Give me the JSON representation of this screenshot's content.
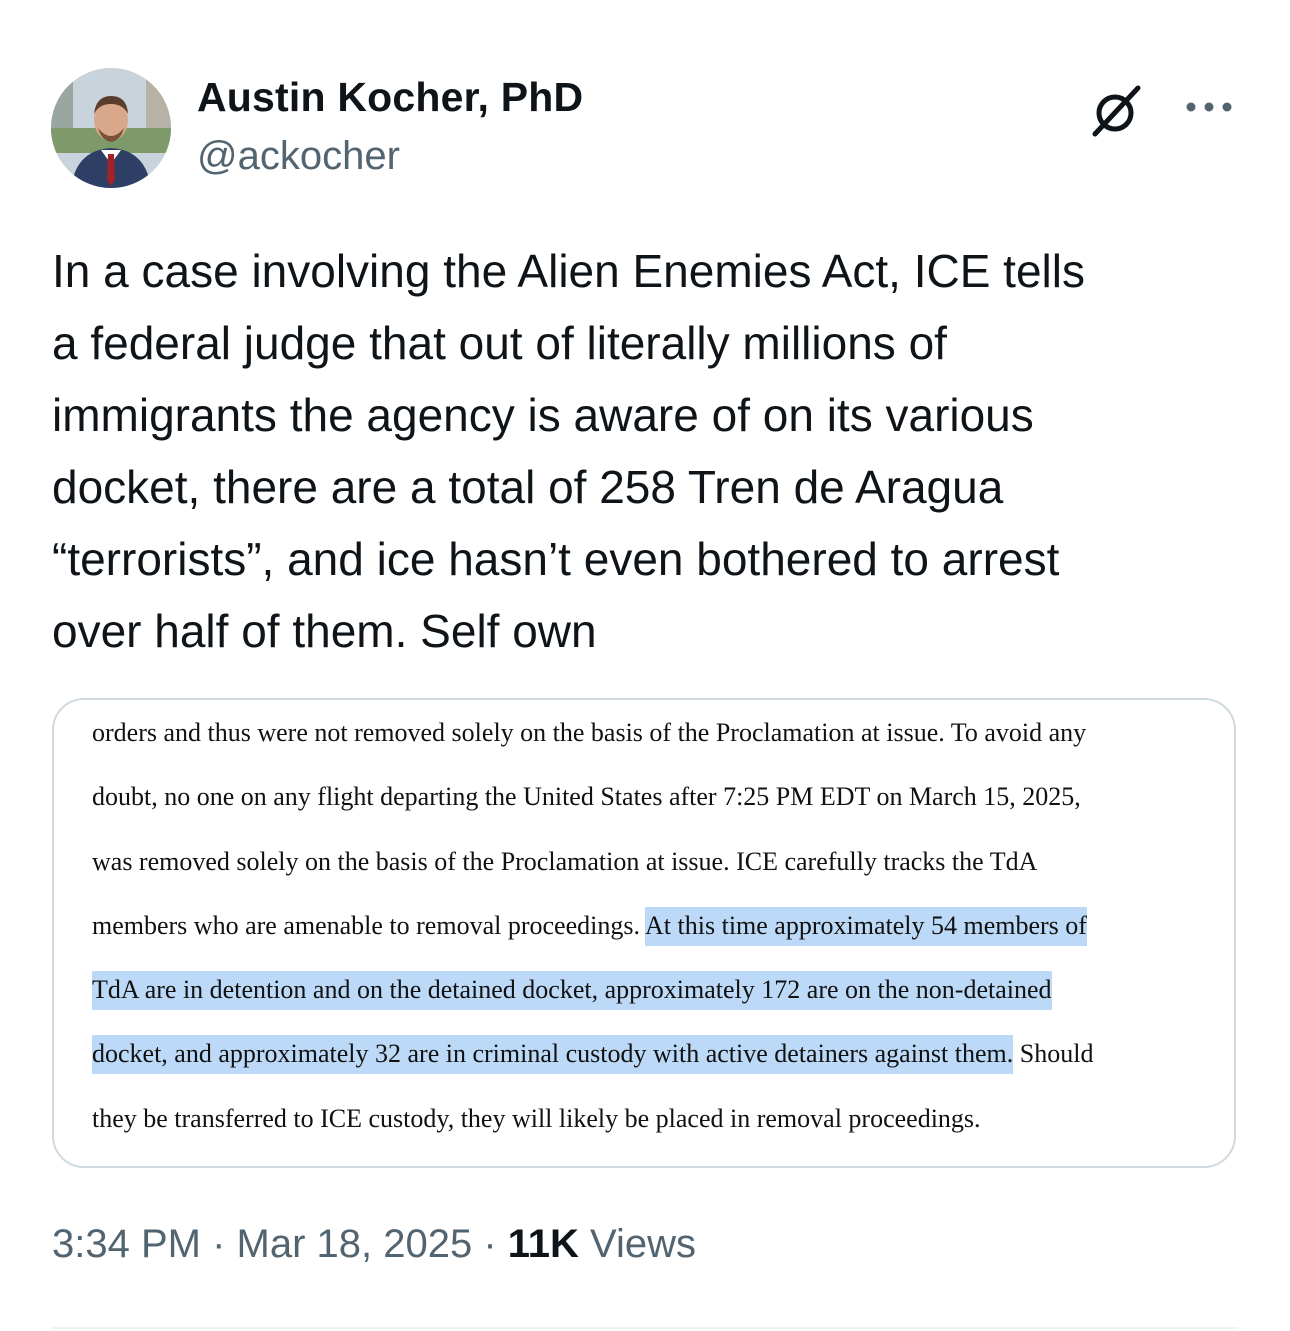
{
  "author": {
    "name": "Austin Kocher, PhD",
    "handle": "@ackocher"
  },
  "icons": {
    "grok": "grok-icon",
    "more": "more-icon"
  },
  "tweet": {
    "text": "In a case involving the Alien Enemies Act, ICE tells\na federal judge that out of literally millions of\nimmigrants the agency is aware of on its various\ndocket, there are a total of 258 Tren de Aragua\n“terrorists”, and ice hasn’t even bothered to arrest\nover half of them. Self own"
  },
  "media": {
    "lines": [
      {
        "pre": "orders and thus were not removed solely on the basis of the Proclamation at issue.  To avoid any",
        "hl": "",
        "post": ""
      },
      {
        "pre": "doubt, no one on any flight departing the United States after 7:25 PM EDT on March 15, 2025,",
        "hl": "",
        "post": ""
      },
      {
        "pre": "was removed solely on the basis of the Proclamation at issue. ICE carefully tracks the TdA",
        "hl": "",
        "post": ""
      },
      {
        "pre": "members who are amenable to removal proceedings. ",
        "hl": "At this time approximately 54 members of",
        "post": ""
      },
      {
        "pre": "",
        "hl": "TdA are in detention and on the detained docket, approximately 172 are on the non-detained",
        "post": ""
      },
      {
        "pre": "",
        "hl": "docket, and approximately 32 are in criminal custody with active detainers against them.",
        "post": " Should"
      },
      {
        "pre": "they be transferred to ICE custody, they will likely be placed in removal proceedings.",
        "hl": "",
        "post": ""
      }
    ],
    "highlight_color": "#bcd9f7"
  },
  "meta": {
    "time": "3:34 PM",
    "sep1": " · ",
    "date": "Mar 18, 2025",
    "sep2": " · ",
    "views_count": "11K",
    "views_label": " Views"
  },
  "colors": {
    "text": "#0f1419",
    "secondary": "#536471",
    "border": "#cfd9de"
  }
}
